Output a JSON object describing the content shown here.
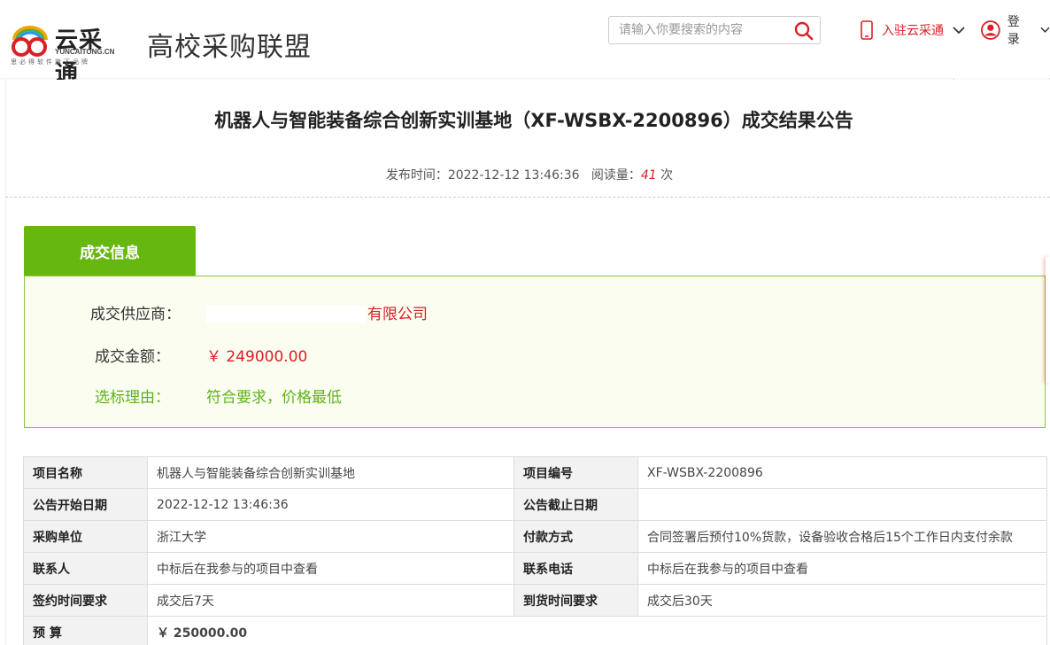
{
  "header": {
    "logo_text": "云采通",
    "logo_sub": "YUNCAITONG.CN",
    "logo_slogan": "思必得软件旗下品牌",
    "site_title": "高校采购联盟",
    "search_placeholder": "请输入你要搜索的内容",
    "join_label": "入驻云采通",
    "login_label": "登 录"
  },
  "article": {
    "title": "机器人与智能装备综合创新实训基地（XF-WSBX-2200896）成交结果公告",
    "publish_label": "发布时间：",
    "publish_time": "2022-12-12 13:46:36",
    "views_label": "阅读量：",
    "views_count": "41",
    "views_unit": "次"
  },
  "deal": {
    "tab_label": "成交信息",
    "supplier_label": "成交供应商：",
    "supplier_value": "有限公司",
    "amount_label": "成交金额：",
    "amount_value": "￥ 249000.00",
    "reason_label": "选标理由：",
    "reason_value": "符合要求，价格最低"
  },
  "table": {
    "rows": [
      {
        "k1": "项目名称",
        "v1": "机器人与智能装备综合创新实训基地",
        "k2": "项目编号",
        "v2": "XF-WSBX-2200896"
      },
      {
        "k1": "公告开始日期",
        "v1": "2022-12-12 13:46:36",
        "k2": "公告截止日期",
        "v2": ""
      },
      {
        "k1": "采购单位",
        "v1": "浙江大学",
        "k2": "付款方式",
        "v2": "合同签署后预付10%货款，设备验收合格后15个工作日内支付余款"
      },
      {
        "k1": "联系人",
        "v1": "中标后在我参与的项目中查看",
        "k2": "联系电话",
        "v2": "中标后在我参与的项目中查看"
      },
      {
        "k1": "签约时间要求",
        "v1": "成交后7天",
        "k2": "到货时间要求",
        "v2": "成交后30天"
      }
    ],
    "budget_label": "预 算",
    "budget_value": "￥ 250000.00"
  },
  "colors": {
    "accent_red": "#d92024",
    "accent_green": "#67b711"
  }
}
